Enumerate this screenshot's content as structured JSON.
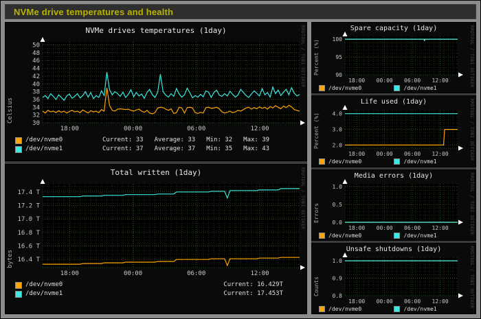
{
  "page_title": "NVMe drive temperatures and health",
  "watermark": "RRDTOOL / TOBI OETIKER",
  "colors": {
    "nvme0": "#ffa500",
    "nvme1": "#3ce8e0",
    "title_accent": "#b9b400",
    "grid_green": "#1d5c1d",
    "grid_olive": "#50502a"
  },
  "chart_data": [
    {
      "type": "line",
      "title": "NVMe drives temperatures (1day)",
      "ylabel": "Celsius",
      "ylim": [
        30,
        50.8
      ],
      "yticks": [
        {
          "v": 30,
          "label": "30"
        },
        {
          "v": 32,
          "label": "32"
        },
        {
          "v": 34,
          "label": "34"
        },
        {
          "v": 36,
          "label": "36"
        },
        {
          "v": 38,
          "label": "38"
        },
        {
          "v": 40,
          "label": "40"
        },
        {
          "v": 42,
          "label": "42"
        },
        {
          "v": 44,
          "label": "44"
        },
        {
          "v": 46,
          "label": "46"
        },
        {
          "v": 48,
          "label": "48"
        },
        {
          "v": 50,
          "label": "50"
        }
      ],
      "yminor_step": 1,
      "xticks": [
        {
          "pos": 0.105,
          "label": "18:00"
        },
        {
          "pos": 0.352,
          "label": "00:00"
        },
        {
          "pos": 0.598,
          "label": "06:00"
        },
        {
          "pos": 0.845,
          "label": "12:00"
        }
      ],
      "series": [
        {
          "name": "/dev/nvme0",
          "color": "#ffa500",
          "values": [
            33.0,
            32.5,
            33.2,
            32.8,
            33.0,
            32.6,
            33.1,
            32.7,
            33.0,
            32.5,
            32.9,
            33.2,
            32.8,
            33.0,
            32.6,
            33.3,
            32.9,
            32.5,
            33.1,
            32.8,
            33.0,
            32.6,
            33.4,
            33.0,
            39.0,
            34.5,
            33.2,
            33.0,
            33.5,
            33.6,
            33.5,
            33.4,
            33.5,
            33.2,
            33.0,
            33.3,
            33.5,
            33.0,
            32.7,
            33.2,
            32.5,
            32.3,
            32.6,
            33.8,
            34.0,
            33.9,
            33.5,
            33.2,
            33.6,
            32.4,
            32.6,
            34.0,
            33.8,
            32.5,
            33.9,
            34.0,
            33.8,
            32.6,
            32.4,
            32.7,
            32.5,
            33.9,
            34.0,
            33.7,
            33.8,
            34.0,
            33.6,
            32.8,
            32.5,
            32.7,
            33.0,
            32.6,
            32.8,
            33.2,
            33.0,
            33.4,
            33.8,
            34.0,
            33.5,
            33.9,
            33.6,
            34.1,
            33.7,
            34.0,
            33.5,
            34.2,
            33.8,
            34.4,
            34.0,
            33.6,
            34.3,
            33.9,
            34.5,
            34.1,
            33.4,
            33.2,
            33.0
          ]
        },
        {
          "name": "/dev/nvme1",
          "color": "#3ce8e0",
          "values": [
            36.5,
            37.0,
            36.2,
            37.5,
            36.8,
            36.0,
            37.2,
            36.5,
            35.8,
            36.9,
            37.4,
            36.3,
            36.8,
            37.5,
            36.4,
            37.0,
            38.0,
            36.6,
            37.8,
            36.2,
            37.0,
            36.5,
            38.2,
            37.0,
            43.0,
            38.5,
            37.2,
            38.0,
            37.5,
            36.8,
            37.9,
            36.5,
            37.3,
            38.5,
            36.7,
            37.8,
            36.9,
            37.4,
            36.3,
            37.8,
            38.6,
            37.2,
            36.5,
            37.9,
            42.5,
            38.0,
            37.1,
            36.6,
            37.5,
            36.8,
            38.8,
            37.4,
            36.6,
            37.2,
            38.9,
            37.7,
            36.4,
            37.0,
            36.6,
            37.3,
            36.7,
            38.2,
            37.9,
            36.5,
            37.8,
            38.4,
            37.1,
            36.8,
            37.5,
            36.9,
            38.1,
            37.3,
            36.6,
            37.2,
            38.6,
            37.8,
            37.0,
            36.5,
            37.4,
            38.2,
            37.6,
            36.9,
            38.8,
            37.2,
            37.8,
            36.6,
            39.2,
            37.5,
            38.4,
            37.0,
            37.9,
            38.6,
            37.2,
            39.0,
            37.6,
            36.9,
            37.3
          ]
        }
      ],
      "legend": [
        {
          "name": "/dev/nvme0",
          "color": "#ffa500",
          "stats": [
            "Current: 33",
            "Average: 33",
            "Min: 32",
            "Max: 39"
          ]
        },
        {
          "name": "/dev/nvme1",
          "color": "#3ce8e0",
          "stats": [
            "Current: 37",
            "Average: 37",
            "Min: 35",
            "Max: 43"
          ]
        }
      ]
    },
    {
      "type": "line",
      "title": "Total written (1day)",
      "ylabel": "bytes",
      "ylim": [
        16.28,
        17.52
      ],
      "yticks": [
        {
          "v": 16.4,
          "label": "16.4 T"
        },
        {
          "v": 16.6,
          "label": "16.6 T"
        },
        {
          "v": 16.8,
          "label": "16.8 T"
        },
        {
          "v": 17.0,
          "label": "17.0 T"
        },
        {
          "v": 17.2,
          "label": "17.2 T"
        },
        {
          "v": 17.4,
          "label": "17.4 T"
        }
      ],
      "yminor_step": 0.05,
      "xticks": [
        {
          "pos": 0.105,
          "label": "18:00"
        },
        {
          "pos": 0.352,
          "label": "00:00"
        },
        {
          "pos": 0.598,
          "label": "06:00"
        },
        {
          "pos": 0.845,
          "label": "12:00"
        }
      ],
      "series": [
        {
          "name": "/dev/nvme0",
          "color": "#ffa500",
          "values": [
            16.33,
            16.33,
            16.33,
            16.33,
            16.33,
            16.33,
            16.33,
            16.33,
            16.33,
            16.33,
            16.33,
            16.33,
            16.33,
            16.33,
            16.33,
            16.34,
            16.34,
            16.34,
            16.34,
            16.34,
            16.34,
            16.34,
            16.34,
            16.35,
            16.35,
            16.35,
            16.35,
            16.35,
            16.35,
            16.35,
            16.35,
            16.36,
            16.36,
            16.36,
            16.36,
            16.36,
            16.36,
            16.36,
            16.36,
            16.36,
            16.36,
            16.36,
            16.36,
            16.37,
            16.37,
            16.37,
            16.37,
            16.37,
            16.37,
            16.37,
            16.4,
            16.4,
            16.4,
            16.4,
            16.4,
            16.4,
            16.4,
            16.4,
            16.4,
            16.4,
            16.4,
            16.4,
            16.4,
            16.41,
            16.41,
            16.41,
            16.41,
            16.41,
            16.41,
            16.31,
            16.41,
            16.41,
            16.41,
            16.41,
            16.41,
            16.41,
            16.41,
            16.41,
            16.41,
            16.41,
            16.41,
            16.42,
            16.42,
            16.42,
            16.42,
            16.42,
            16.42,
            16.42,
            16.42,
            16.43,
            16.43,
            16.43,
            16.43,
            16.43,
            16.43,
            16.43,
            16.43
          ]
        },
        {
          "name": "/dev/nvme1",
          "color": "#3ce8e0",
          "values": [
            17.33,
            17.33,
            17.33,
            17.33,
            17.33,
            17.33,
            17.33,
            17.33,
            17.33,
            17.33,
            17.33,
            17.33,
            17.33,
            17.33,
            17.33,
            17.34,
            17.34,
            17.34,
            17.34,
            17.34,
            17.34,
            17.34,
            17.34,
            17.35,
            17.35,
            17.35,
            17.35,
            17.35,
            17.35,
            17.35,
            17.35,
            17.36,
            17.36,
            17.36,
            17.36,
            17.36,
            17.36,
            17.36,
            17.36,
            17.36,
            17.36,
            17.36,
            17.36,
            17.37,
            17.37,
            17.37,
            17.37,
            17.37,
            17.37,
            17.37,
            17.4,
            17.4,
            17.4,
            17.4,
            17.4,
            17.4,
            17.4,
            17.4,
            17.4,
            17.4,
            17.4,
            17.4,
            17.4,
            17.41,
            17.41,
            17.41,
            17.41,
            17.41,
            17.41,
            17.31,
            17.42,
            17.42,
            17.42,
            17.42,
            17.42,
            17.42,
            17.42,
            17.42,
            17.42,
            17.42,
            17.42,
            17.43,
            17.43,
            17.43,
            17.43,
            17.43,
            17.43,
            17.43,
            17.43,
            17.45,
            17.45,
            17.45,
            17.45,
            17.45,
            17.45,
            17.45,
            17.45
          ]
        }
      ],
      "legend_align": "right",
      "legend": [
        {
          "name": "/dev/nvme0",
          "color": "#ffa500",
          "stats": [
            "Current:  16.429T"
          ]
        },
        {
          "name": "/dev/nvme1",
          "color": "#3ce8e0",
          "stats": [
            "Current:  17.453T"
          ]
        }
      ]
    },
    {
      "type": "line",
      "title": "Spare capacity (1day)",
      "ylabel": "Percent (%)",
      "ylim": [
        90,
        100.8
      ],
      "yticks": [
        {
          "v": 90,
          "label": "90"
        },
        {
          "v": 95,
          "label": "95"
        },
        {
          "v": 100,
          "label": "100"
        }
      ],
      "yminor_step": 1,
      "xticks": [
        {
          "pos": 0.105,
          "label": "18:00"
        },
        {
          "pos": 0.352,
          "label": "00:00"
        },
        {
          "pos": 0.598,
          "label": "06:00"
        },
        {
          "pos": 0.845,
          "label": "12:00"
        }
      ],
      "series": [
        {
          "name": "/dev/nvme0",
          "color": "#ffa500",
          "points": [
            [
              0,
              100
            ],
            [
              1,
              100
            ]
          ]
        },
        {
          "name": "/dev/nvme1",
          "color": "#3ce8e0",
          "points": [
            [
              0,
              100
            ],
            [
              0.7,
              100
            ],
            [
              0.705,
              99.6
            ],
            [
              0.715,
              100
            ],
            [
              1,
              100
            ]
          ]
        }
      ],
      "legend_inline": true,
      "legend": [
        {
          "name": "/dev/nvme0",
          "color": "#ffa500",
          "stats": []
        },
        {
          "name": "/dev/nvme1",
          "color": "#3ce8e0",
          "stats": []
        }
      ]
    },
    {
      "type": "line",
      "title": "Life used (1day)",
      "ylabel": "Percent (%)",
      "ylim": [
        1.8,
        4.25
      ],
      "yticks": [
        {
          "v": 2.0,
          "label": "2.0"
        },
        {
          "v": 3.0,
          "label": "3.0"
        },
        {
          "v": 4.0,
          "label": "4.0"
        }
      ],
      "yminor_step": 0.2,
      "xticks": [
        {
          "pos": 0.105,
          "label": "18:00"
        },
        {
          "pos": 0.352,
          "label": "00:00"
        },
        {
          "pos": 0.598,
          "label": "06:00"
        },
        {
          "pos": 0.845,
          "label": "12:00"
        }
      ],
      "series": [
        {
          "name": "/dev/nvme0",
          "color": "#ffa500",
          "points": [
            [
              0,
              2.0
            ],
            [
              0.875,
              2.0
            ],
            [
              0.885,
              3.0
            ],
            [
              1,
              3.0
            ]
          ]
        },
        {
          "name": "/dev/nvme1",
          "color": "#3ce8e0",
          "points": [
            [
              0,
              4.0
            ],
            [
              1,
              4.0
            ]
          ]
        }
      ],
      "legend_inline": true,
      "legend": [
        {
          "name": "/dev/nvme0",
          "color": "#ffa500",
          "stats": []
        },
        {
          "name": "/dev/nvme1",
          "color": "#3ce8e0",
          "stats": []
        }
      ]
    },
    {
      "type": "line",
      "title": "Media errors (1day)",
      "ylabel": "Errors",
      "ylim": [
        0,
        1.08
      ],
      "yticks": [
        {
          "v": 0.0,
          "label": "0.0"
        },
        {
          "v": 0.5,
          "label": "0.5"
        },
        {
          "v": 1.0,
          "label": "1.0"
        }
      ],
      "yminor_step": 0.1,
      "xticks": [
        {
          "pos": 0.105,
          "label": "18:00"
        },
        {
          "pos": 0.352,
          "label": "00:00"
        },
        {
          "pos": 0.598,
          "label": "06:00"
        },
        {
          "pos": 0.845,
          "label": "12:00"
        }
      ],
      "series": [
        {
          "name": "/dev/nvme0",
          "color": "#ffa500",
          "points": [
            [
              0,
              0
            ],
            [
              1,
              0
            ]
          ]
        },
        {
          "name": "/dev/nvme1",
          "color": "#3ce8e0",
          "points": [
            [
              0,
              0
            ],
            [
              1,
              0
            ]
          ]
        }
      ],
      "legend_inline": true,
      "legend": [
        {
          "name": "/dev/nvme0",
          "color": "#ffa500",
          "stats": []
        },
        {
          "name": "/dev/nvme1",
          "color": "#3ce8e0",
          "stats": []
        }
      ]
    },
    {
      "type": "line",
      "title": "Unsafe shutdowns (1day)",
      "ylabel": "Counts",
      "ylim": [
        0.8,
        1.02
      ],
      "yticks": [
        {
          "v": 0.8,
          "label": "0.8"
        },
        {
          "v": 0.9,
          "label": "0.9"
        },
        {
          "v": 1.0,
          "label": "1.0"
        }
      ],
      "yminor_step": 0.02,
      "xticks": [
        {
          "pos": 0.105,
          "label": "18:00"
        },
        {
          "pos": 0.352,
          "label": "00:00"
        },
        {
          "pos": 0.598,
          "label": "06:00"
        },
        {
          "pos": 0.845,
          "label": "12:00"
        }
      ],
      "series": [
        {
          "name": "/dev/nvme0",
          "color": "#ffa500",
          "points": [
            [
              0,
              1.0
            ],
            [
              1,
              1.0
            ]
          ]
        },
        {
          "name": "/dev/nvme1",
          "color": "#3ce8e0",
          "points": [
            [
              0,
              1.0
            ],
            [
              1,
              1.0
            ]
          ]
        }
      ],
      "legend_inline": true,
      "legend": [
        {
          "name": "/dev/nvme0",
          "color": "#ffa500",
          "stats": []
        },
        {
          "name": "/dev/nvme1",
          "color": "#3ce8e0",
          "stats": []
        }
      ]
    }
  ]
}
